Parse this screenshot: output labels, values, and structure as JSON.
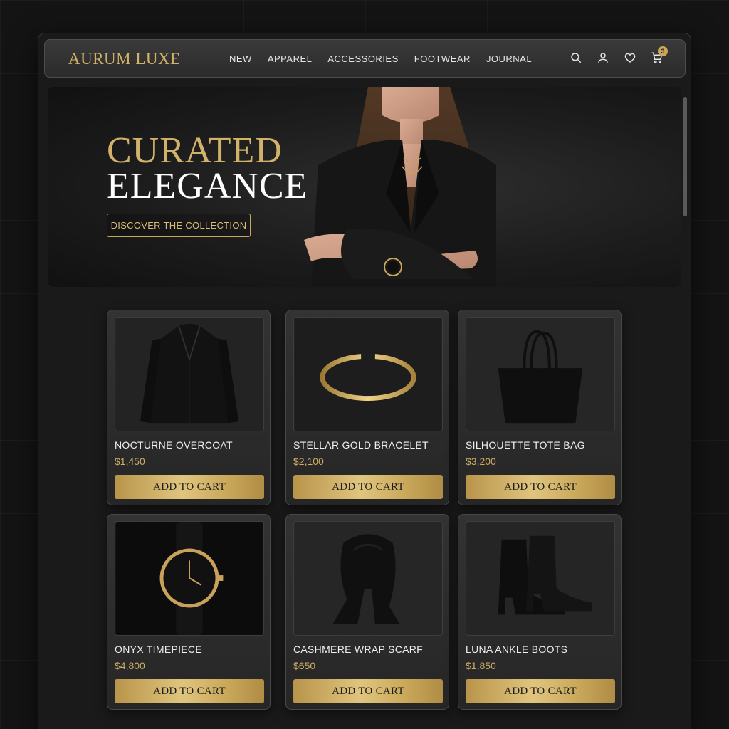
{
  "brand": {
    "logo": "AURUM LUXE",
    "accent": "#c9a85a"
  },
  "nav": {
    "links": [
      "NEW",
      "APPAREL",
      "ACCESSORIES",
      "FOOTWEAR",
      "JOURNAL"
    ],
    "icons": [
      "search-icon",
      "user-icon",
      "heart-icon",
      "cart-icon"
    ],
    "cart_count": "3"
  },
  "hero": {
    "title_line1": "CURATED",
    "title_line2": "ELEGANCE",
    "cta": "DISCOVER THE COLLECTION"
  },
  "products": [
    {
      "name": "NOCTURNE OVERCOAT",
      "price": "$1,450",
      "button": "ADD TO CART",
      "image": "overcoat"
    },
    {
      "name": "STELLAR GOLD BRACELET",
      "price": "$2,100",
      "button": "ADD TO CART",
      "image": "bracelet"
    },
    {
      "name": "SILHOUETTE TOTE BAG",
      "price": "$3,200",
      "button": "ADD TO CART",
      "image": "tote-bag"
    },
    {
      "name": "ONYX TIMEPIECE",
      "price": "$4,800",
      "button": "ADD TO CART",
      "image": "watch"
    },
    {
      "name": "CASHMERE WRAP SCARF",
      "price": "$650",
      "button": "ADD TO CART",
      "image": "scarf"
    },
    {
      "name": "LUNA ANKLE BOOTS",
      "price": "$1,850",
      "button": "ADD TO CART",
      "image": "ankle-boots"
    }
  ]
}
